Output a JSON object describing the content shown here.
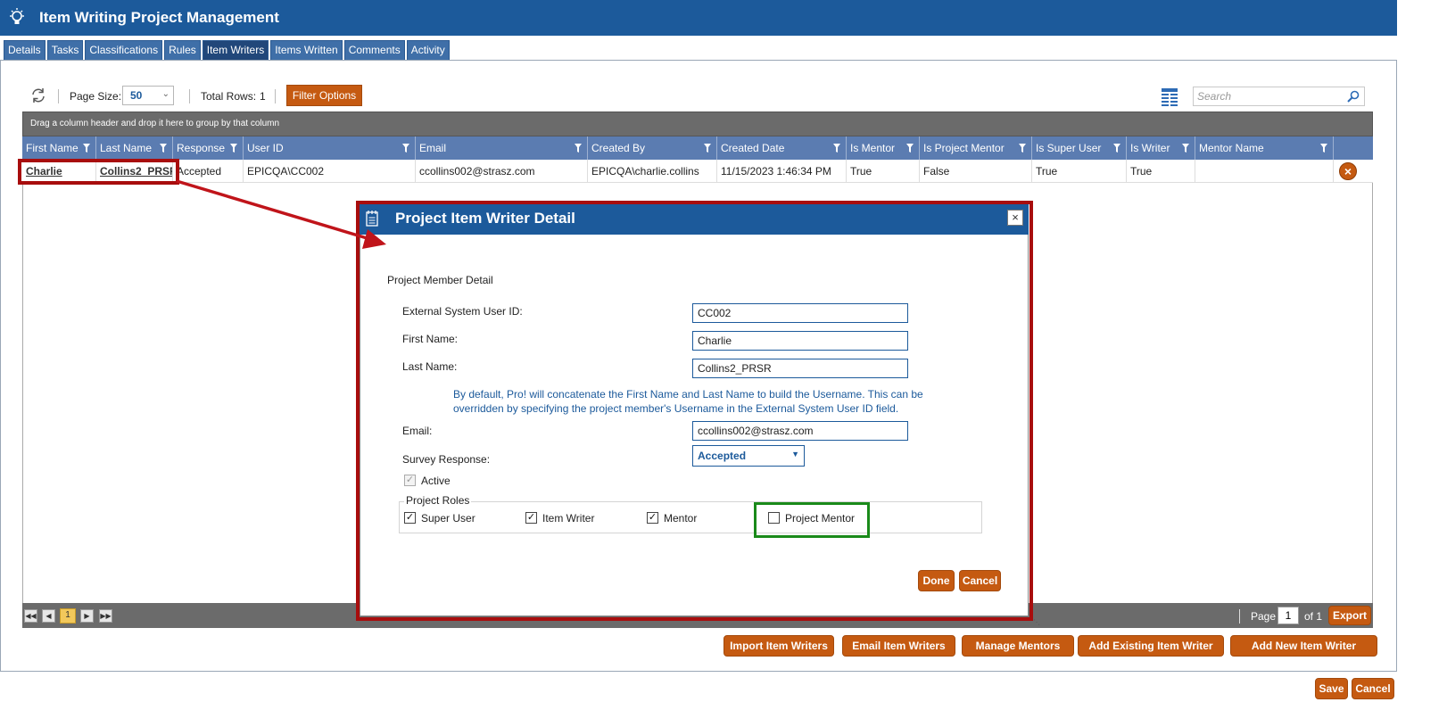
{
  "app": {
    "title": "Item Writing Project Management",
    "logo_icon": "lightbulb-icon"
  },
  "tabs": [
    {
      "label": "Details"
    },
    {
      "label": "Tasks"
    },
    {
      "label": "Classifications"
    },
    {
      "label": "Rules"
    },
    {
      "label": "Item Writers",
      "active": true
    },
    {
      "label": "Items Written"
    },
    {
      "label": "Comments"
    },
    {
      "label": "Activity"
    }
  ],
  "toolbar": {
    "page_size_label": "Page Size:",
    "page_size_value": "50",
    "total_rows_label": "Total Rows:",
    "total_rows_value": "1",
    "filter_button": "Filter Options",
    "search_placeholder": "Search"
  },
  "grid": {
    "group_hint": "Drag a column header and drop it here to group by that column",
    "columns": [
      "First Name",
      "Last Name",
      "Response",
      "User ID",
      "Email",
      "Created By",
      "Created Date",
      "Is Mentor",
      "Is Project Mentor",
      "Is Super User",
      "Is Writer",
      "Mentor Name"
    ],
    "rows": [
      [
        "Charlie",
        "Collins2_PRSR",
        "Accepted",
        "EPICQA\\CC002",
        "ccollins002@strasz.com",
        "EPICQA\\charlie.collins",
        "11/15/2023 1:46:34 PM",
        "True",
        "False",
        "True",
        "True",
        ""
      ]
    ]
  },
  "pager": {
    "current_page": "1",
    "page_label": "Page",
    "page_value": "1",
    "of_label": "of 1",
    "export": "Export"
  },
  "actions": [
    "Import Item Writers",
    "Email Item Writers",
    "Manage Mentors",
    "Add Existing Item Writer",
    "Add New Item Writer"
  ],
  "footer": {
    "save": "Save",
    "cancel": "Cancel"
  },
  "modal": {
    "title": "Project Item Writer Detail",
    "section": "Project Member Detail",
    "external_id_label": "External System User ID:",
    "external_id_value": "CC002",
    "first_name_label": "First Name:",
    "first_name_value": "Charlie",
    "last_name_label": "Last Name:",
    "last_name_value": "Collins2_PRSR",
    "hint_line1": "By default, Pro! will concatenate the First Name and Last Name to build the Username. This can be",
    "hint_line2": "overridden by specifying the project member's Username in the External System User ID field.",
    "email_label": "Email:",
    "email_value": "ccollins002@strasz.com",
    "survey_label": "Survey Response:",
    "survey_value": "Accepted",
    "active_label": "Active",
    "roles_legend": "Project Roles",
    "roles": [
      {
        "label": "Super User",
        "checked": true
      },
      {
        "label": "Item Writer",
        "checked": true
      },
      {
        "label": "Mentor",
        "checked": true
      },
      {
        "label": "Project Mentor",
        "checked": false
      }
    ],
    "done": "Done",
    "cancel": "Cancel"
  },
  "colors": {
    "header_blue": "#1c5a9b",
    "accent_orange": "#c55a11",
    "annotation_red": "#a80d0d",
    "annotation_green": "#1a8a1a"
  }
}
